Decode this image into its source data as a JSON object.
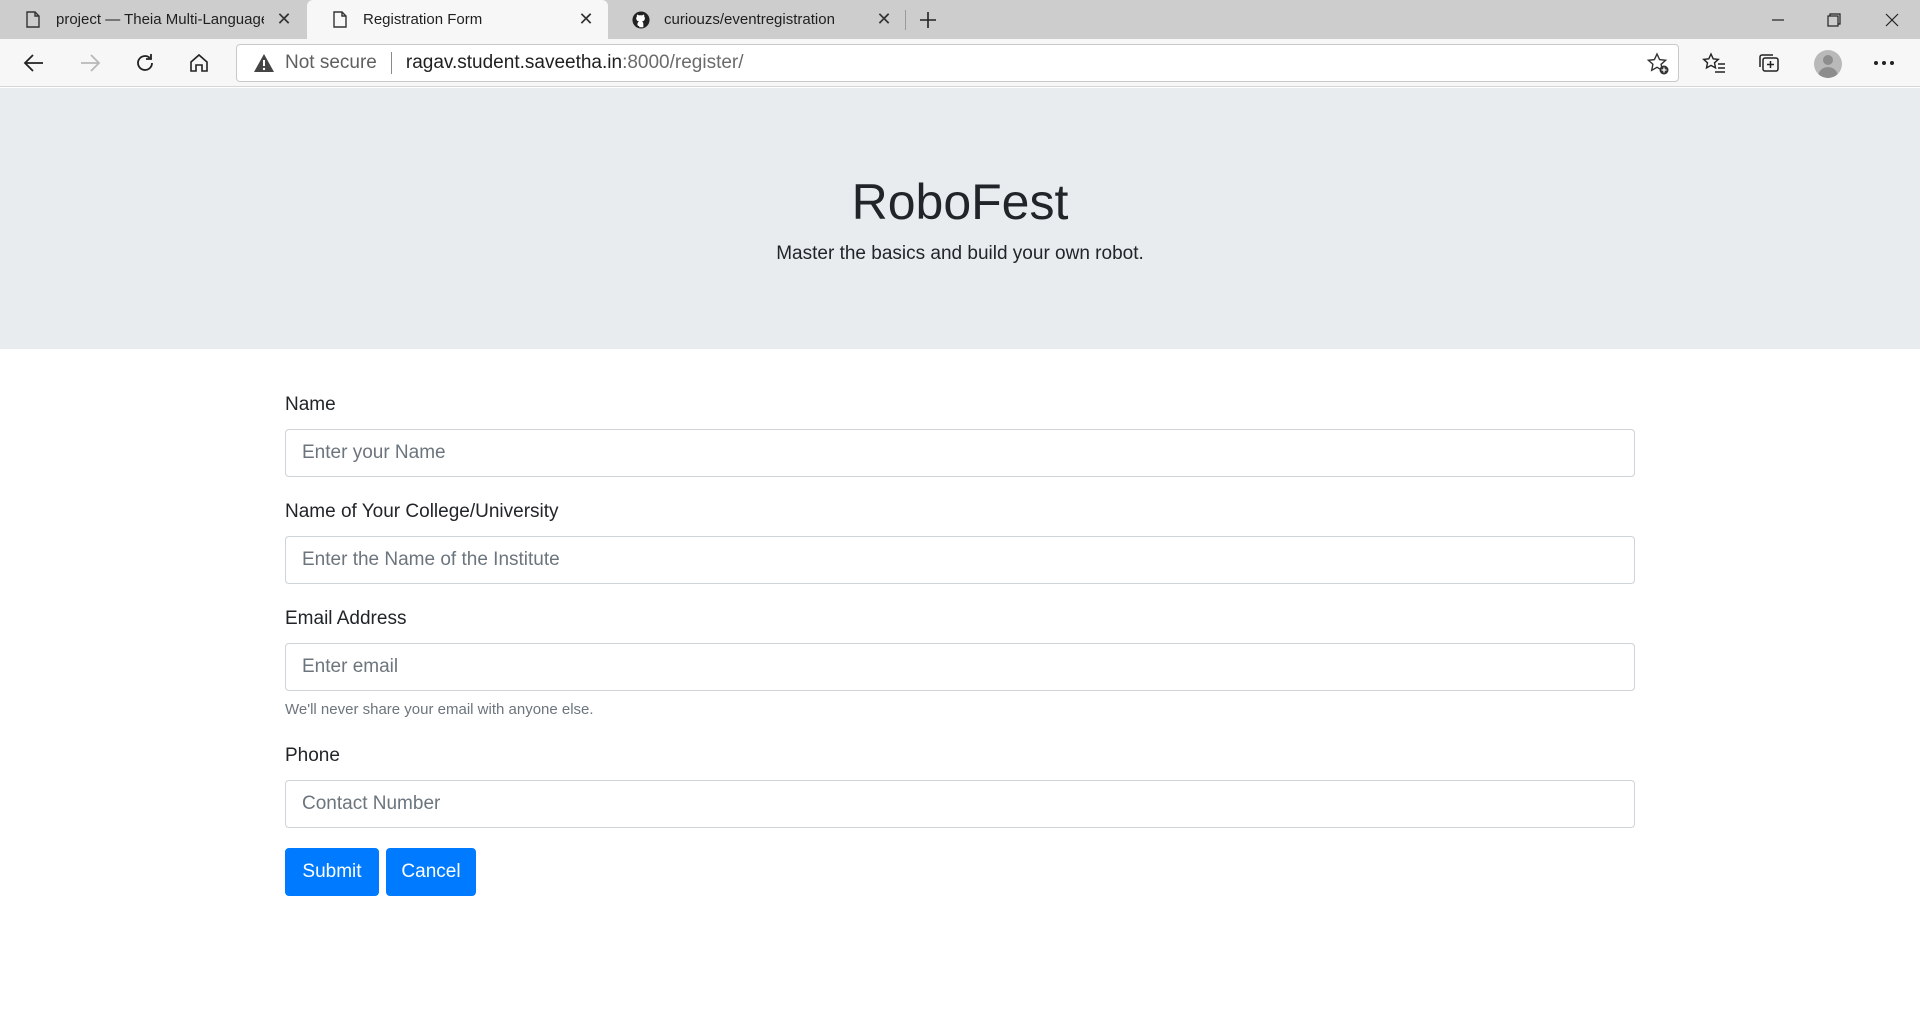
{
  "browser": {
    "tabs": [
      {
        "title": "project — Theia Multi-Language",
        "icon": "page-icon"
      },
      {
        "title": "Registration Form",
        "icon": "page-icon",
        "active": true
      },
      {
        "title": "curiouzs/eventregistration",
        "icon": "github-icon"
      }
    ],
    "address": {
      "security_label": "Not secure",
      "host": "ragav.student.saveetha.in",
      "path": ":8000/register/"
    }
  },
  "page": {
    "title": "RoboFest",
    "subtitle": "Master the basics and build your own robot.",
    "form": {
      "name_label": "Name",
      "name_placeholder": "Enter your Name",
      "college_label": "Name of Your College/University",
      "college_placeholder": "Enter the Name of the Institute",
      "email_label": "Email Address",
      "email_placeholder": "Enter email",
      "email_help": "We'll never share your email with anyone else.",
      "phone_label": "Phone",
      "phone_placeholder": "Contact Number",
      "submit_label": "Submit",
      "cancel_label": "Cancel"
    }
  },
  "colors": {
    "primary": "#007bff",
    "jumbotron_bg": "#e9ecef",
    "tabstrip_bg": "#cdcdcd"
  }
}
